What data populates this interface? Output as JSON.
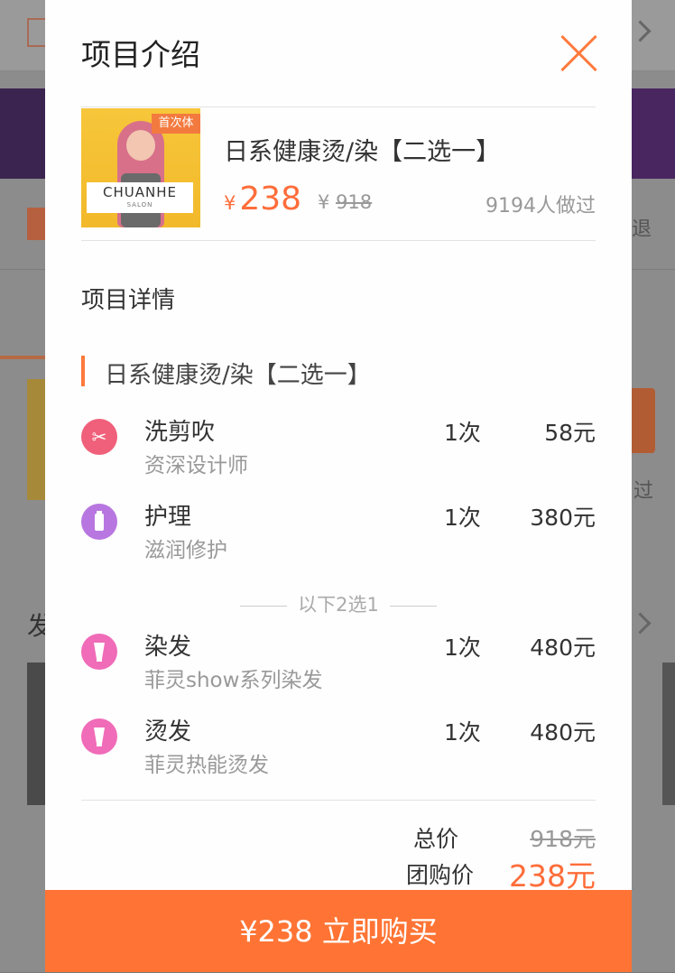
{
  "modal": {
    "title": "项目介绍",
    "product": {
      "badge": "首次体",
      "logo_text": "CHUANHE",
      "logo_sub": "SALON",
      "name": "日系健康烫/染【二选一】",
      "currency": "¥",
      "price": "238",
      "original_price_currency": "¥",
      "original_price": "918",
      "sold": "9194人做过"
    },
    "section_title": "项目详情",
    "group_title": "日系健康烫/染【二选一】",
    "items": [
      {
        "name": "洗剪吹",
        "desc": "资深设计师",
        "qty": "1次",
        "price": "58元",
        "icon": "scissors-icon",
        "color": "#f0607a"
      },
      {
        "name": "护理",
        "desc": "滋润修护",
        "qty": "1次",
        "price": "380元",
        "icon": "bottle-icon",
        "color": "#b877e0"
      },
      {
        "name": "染发",
        "desc": "菲灵show系列染发",
        "qty": "1次",
        "price": "480元",
        "icon": "tube-icon",
        "color": "#f06bb8"
      },
      {
        "name": "烫发",
        "desc": "菲灵热能烫发",
        "qty": "1次",
        "price": "480元",
        "icon": "tube-icon",
        "color": "#f06bb8"
      }
    ],
    "choose_note": "以下2选1",
    "total_label": "总价",
    "total_value": "918元",
    "group_price_label": "团购价",
    "group_price_value": "238元"
  },
  "buy_button": "¥238 立即购买",
  "background": {
    "text_refund": "退",
    "text_done": "过",
    "text_section": "发"
  },
  "colors": {
    "accent": "#ff7434",
    "price": "#ff6d3a"
  }
}
